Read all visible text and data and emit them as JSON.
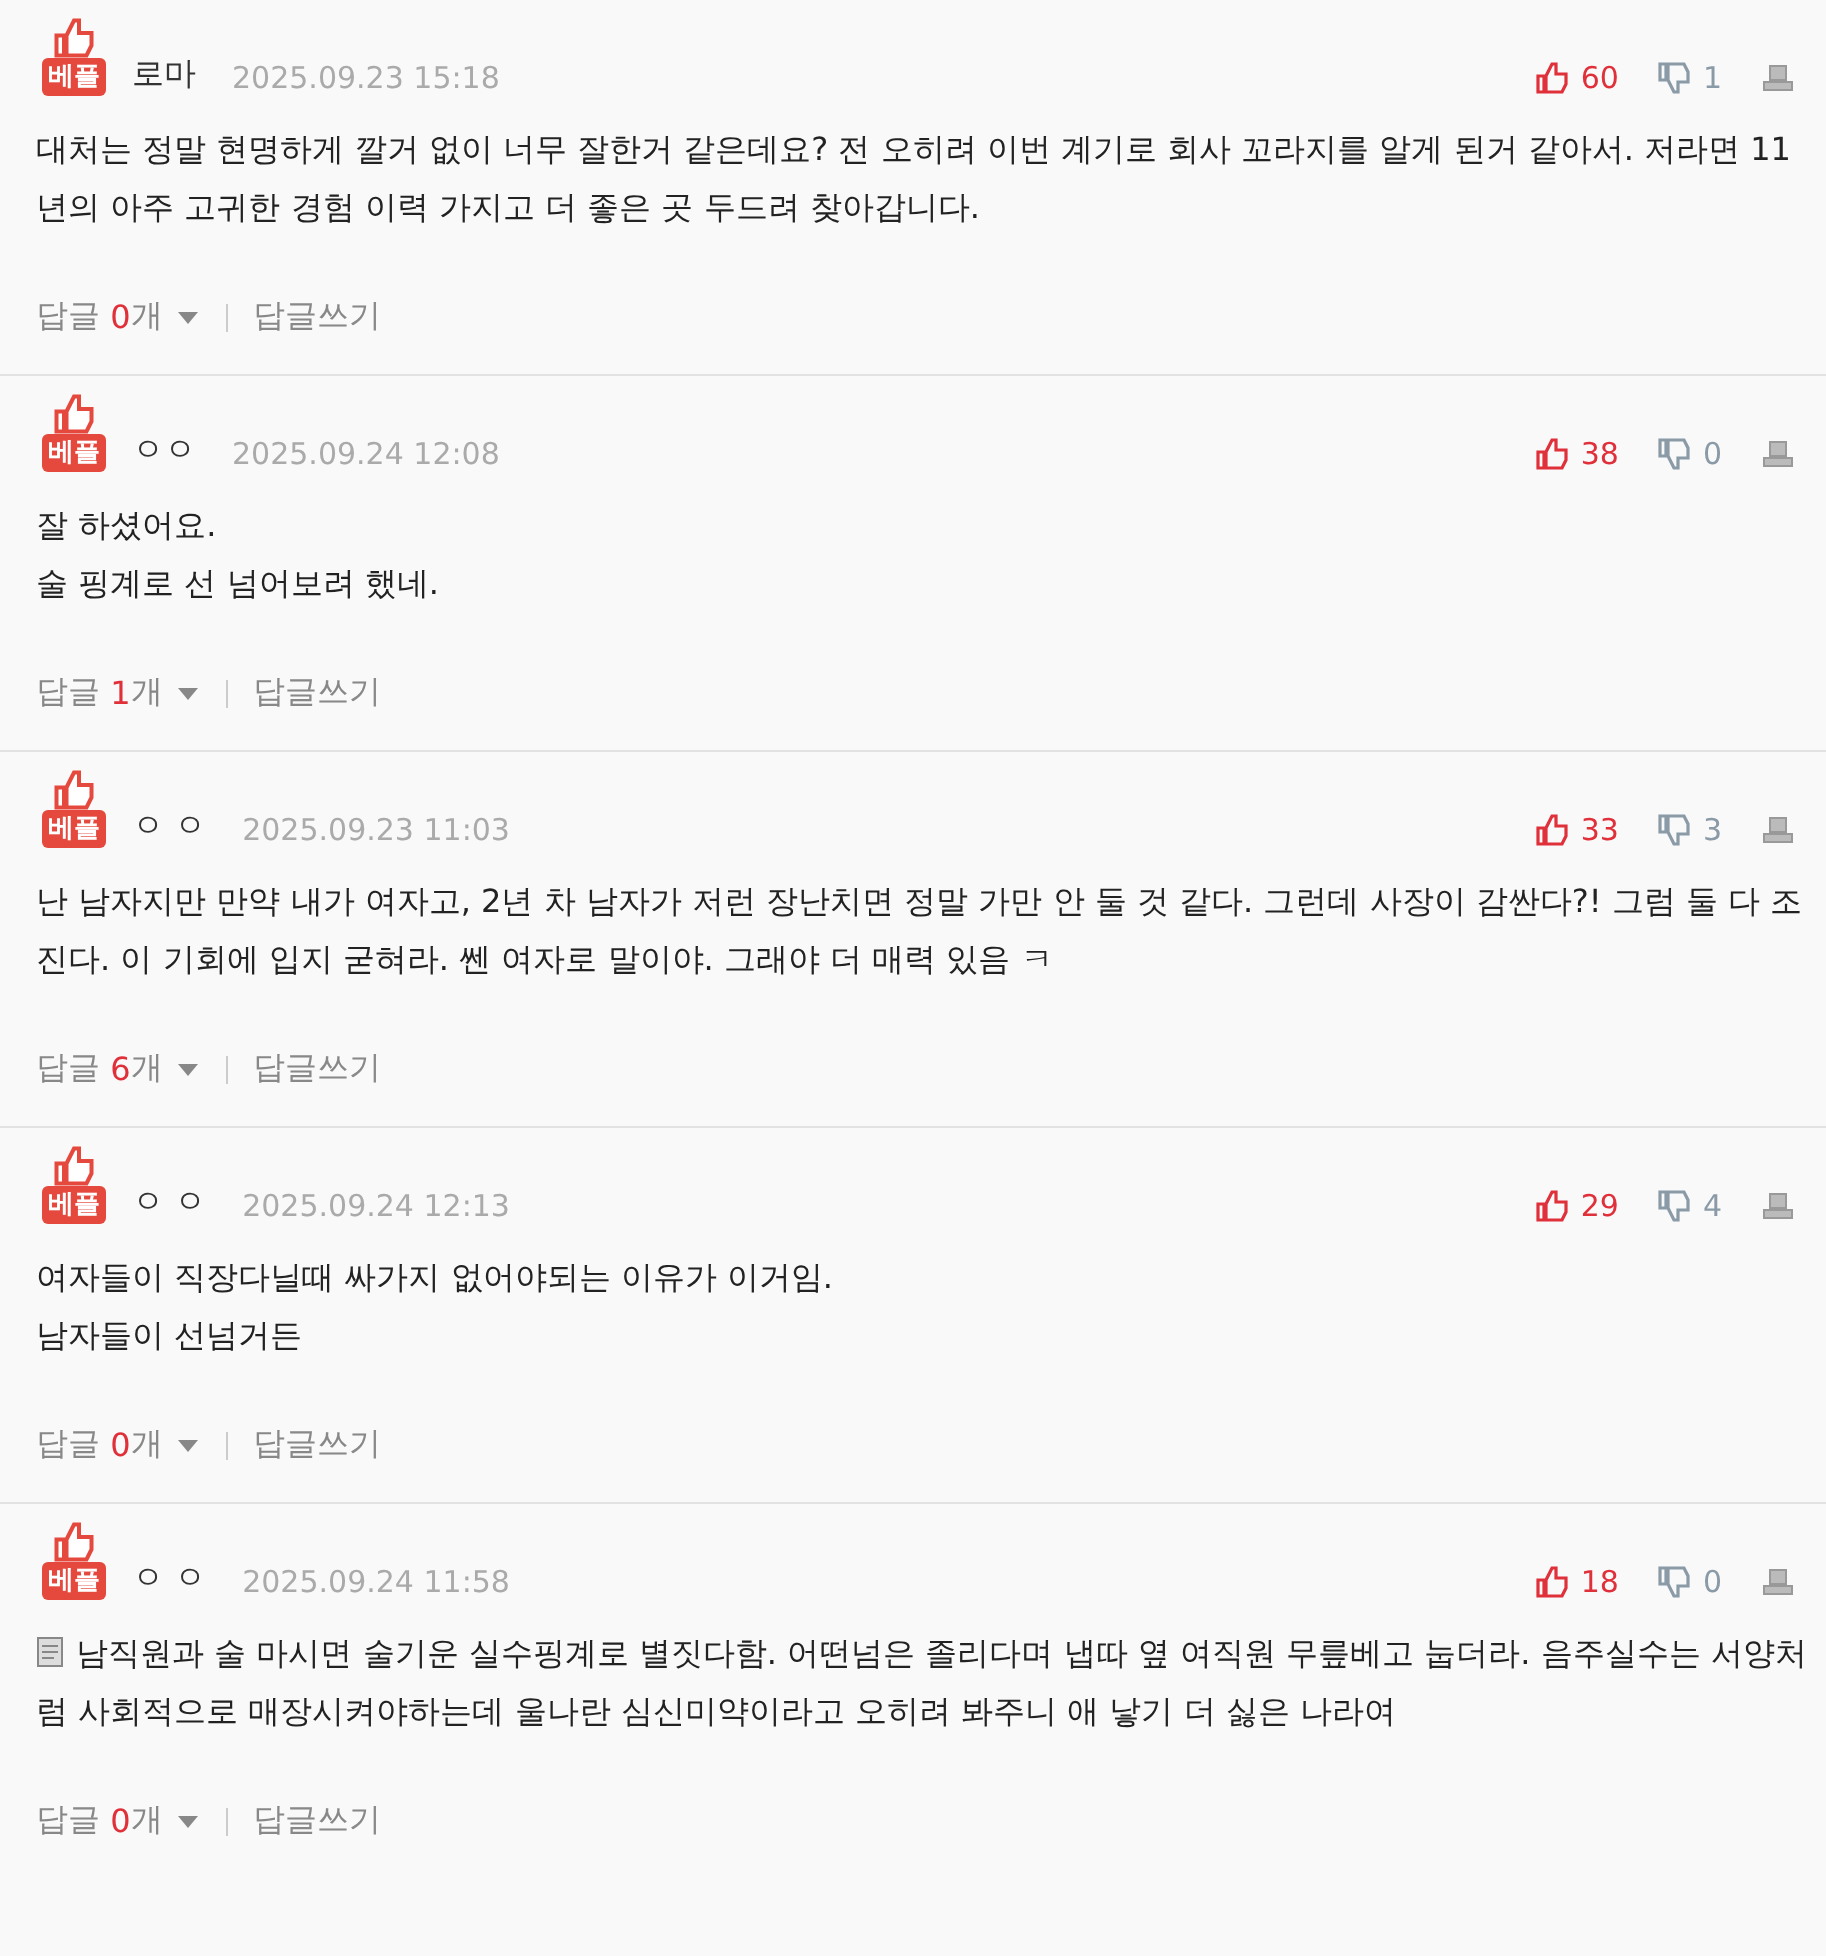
{
  "comments": [
    {
      "badge": "베플",
      "author": "로마",
      "date": "2025.09.23 15:18",
      "likes": "60",
      "dislikes": "1",
      "memo": false,
      "body": [
        "대처는 정말 현명하게 깔거 없이 너무 잘한거 같은데요? 전 오히려 이번 계기로 회사 꼬라지를 알게 된거 같아서. 저라면 11년의 아주 고귀한 경험 이력 가지고 더 좋은 곳 두드려 찾아갑니다."
      ],
      "reply_label": "답글",
      "reply_count": "0",
      "reply_unit": "개",
      "write_reply": "답글쓰기"
    },
    {
      "badge": "베플",
      "author": "ㅇㅇ",
      "date": "2025.09.24 12:08",
      "likes": "38",
      "dislikes": "0",
      "memo": false,
      "body": [
        "잘 하셨어요.",
        "술 핑계로 선 넘어보려 했네."
      ],
      "reply_label": "답글",
      "reply_count": "1",
      "reply_unit": "개",
      "write_reply": "답글쓰기"
    },
    {
      "badge": "베플",
      "author": "ㅇ ㅇ",
      "date": "2025.09.23 11:03",
      "likes": "33",
      "dislikes": "3",
      "memo": false,
      "body": [
        "난 남자지만 만약 내가 여자고, 2년 차 남자가 저런 장난치면 정말 가만 안 둘 것 같다. 그런데 사장이 감싼다?! 그럼 둘 다 조진다. 이 기회에 입지 굳혀라. 쎈 여자로 말이야. 그래야 더 매력 있음 ㅋ"
      ],
      "reply_label": "답글",
      "reply_count": "6",
      "reply_unit": "개",
      "write_reply": "답글쓰기"
    },
    {
      "badge": "베플",
      "author": "ㅇ ㅇ",
      "date": "2025.09.24 12:13",
      "likes": "29",
      "dislikes": "4",
      "memo": false,
      "body": [
        "여자들이 직장다닐때 싸가지 없어야되는 이유가 이거임.",
        "남자들이 선넘거든"
      ],
      "reply_label": "답글",
      "reply_count": "0",
      "reply_unit": "개",
      "write_reply": "답글쓰기"
    },
    {
      "badge": "베플",
      "author": "ㅇ ㅇ",
      "date": "2025.09.24 11:58",
      "likes": "18",
      "dislikes": "0",
      "memo": true,
      "body": [
        "남직원과 술 마시면 술기운 실수핑계로 별짓다함. 어떤넘은 졸리다며 냅따 옆 여직원 무릎베고 눕더라. 음주실수는 서양처럼 사회적으로 매장시켜야하는데 울나란 심신미약이라고 오히려 봐주니 애 낳기 더 싫은 나라여"
      ],
      "reply_label": "답글",
      "reply_count": "0",
      "reply_unit": "개",
      "write_reply": "답글쓰기"
    }
  ]
}
